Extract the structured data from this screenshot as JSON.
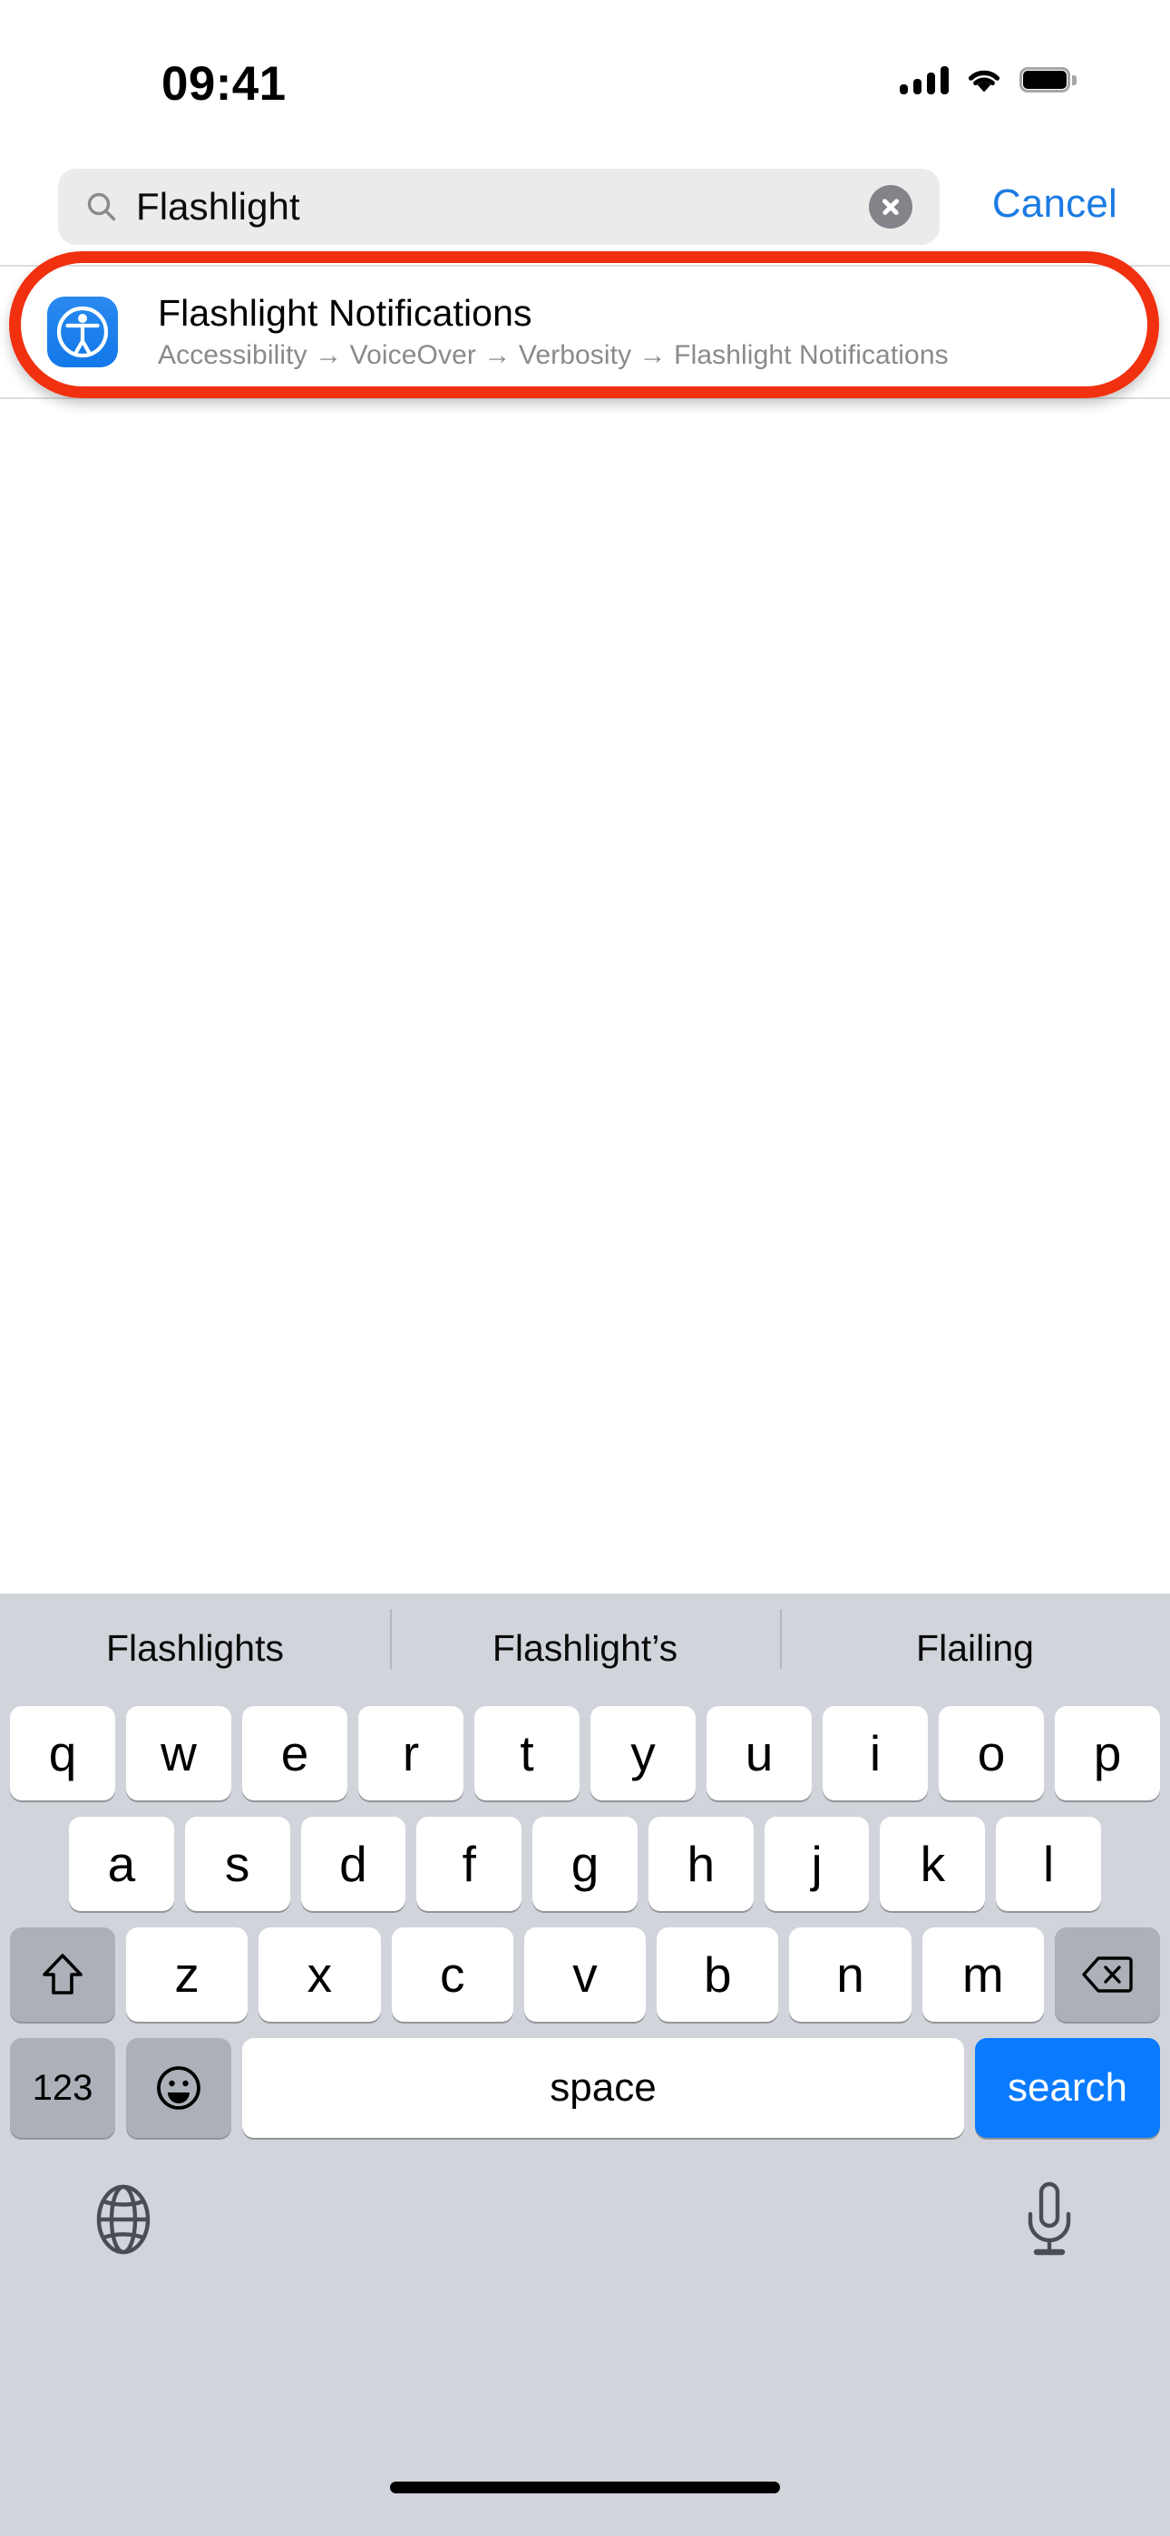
{
  "status_bar": {
    "time": "09:41",
    "cellular_icon": "cellular-signal-icon",
    "cellular_bars": 4,
    "wifi_icon": "wifi-icon",
    "battery_icon": "battery-full-icon"
  },
  "search": {
    "value": "Flashlight",
    "placeholder": "Search",
    "search_icon": "search-icon",
    "clear_icon": "clear-text-icon",
    "cancel_label": "Cancel"
  },
  "result": {
    "icon": "accessibility-icon",
    "icon_color": "#1277E8",
    "title": "Flashlight Notifications",
    "breadcrumb": "Accessibility → VoiceOver → Verbosity → Flashlight Notifications"
  },
  "highlight": {
    "color": "#F0300F",
    "shape": "rounded-oval-outline"
  },
  "keyboard": {
    "suggestions": [
      "Flashlights",
      "Flashlight’s",
      "Flailing"
    ],
    "row1": [
      "q",
      "w",
      "e",
      "r",
      "t",
      "y",
      "u",
      "i",
      "o",
      "p"
    ],
    "row2": [
      "a",
      "s",
      "d",
      "f",
      "g",
      "h",
      "j",
      "k",
      "l"
    ],
    "row3": [
      "z",
      "x",
      "c",
      "v",
      "b",
      "n",
      "m"
    ],
    "shift_icon": "shift-key-icon",
    "delete_icon": "delete-backspace-icon",
    "numbers_label": "123",
    "emoji_icon": "emoji-smiley-icon",
    "space_label": "space",
    "search_label": "search",
    "globe_icon": "globe-keyboard-switch-icon",
    "mic_icon": "microphone-dictation-icon",
    "background_color": "#D1D4DA",
    "key_color": "#FFFFFF",
    "modifier_key_color": "#ACB0B9",
    "search_key_color": "#0A7AFF"
  },
  "home_indicator": "home-indicator-bar"
}
